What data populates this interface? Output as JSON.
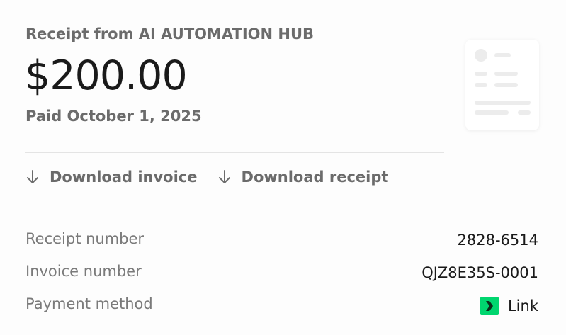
{
  "header": {
    "receipt_from": "Receipt from AI AUTOMATION HUB",
    "amount": "$200.00",
    "paid_date": "Paid October 1, 2025"
  },
  "actions": {
    "download_invoice": "Download invoice",
    "download_receipt": "Download receipt"
  },
  "details": {
    "receipt_number": {
      "label": "Receipt number",
      "value": "2828-6514"
    },
    "invoice_number": {
      "label": "Invoice number",
      "value": "QJZ8E35S-0001"
    },
    "payment_method": {
      "label": "Payment method",
      "value": "Link",
      "icon": "link-logo-icon"
    }
  },
  "colors": {
    "link_brand": "#00d66f",
    "muted_text": "#6b6b6b",
    "primary_text": "#1a1a1a"
  }
}
